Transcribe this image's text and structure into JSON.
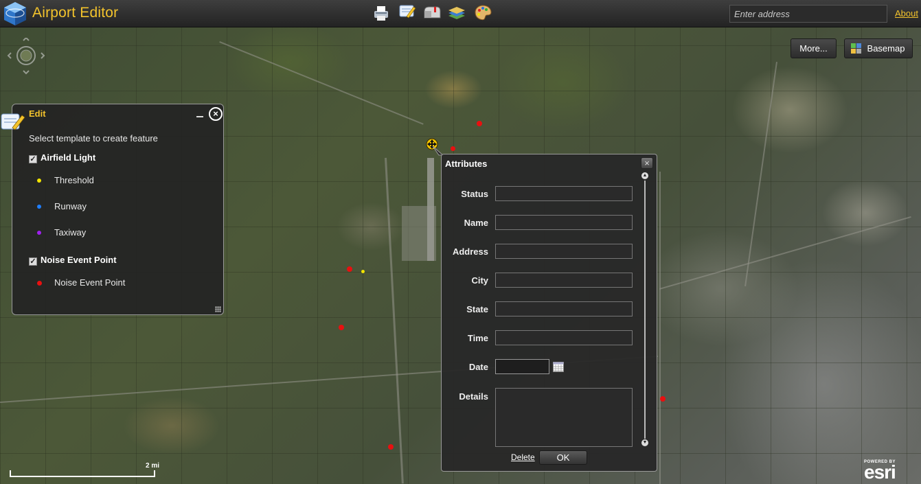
{
  "app": {
    "title": "Airport Editor"
  },
  "toolbar": {
    "tools": [
      "print-tool",
      "edit-tool",
      "mailbox-tool",
      "layers-tool",
      "palette-tool"
    ]
  },
  "search": {
    "placeholder": "Enter address"
  },
  "header": {
    "about_label": "About"
  },
  "map_buttons": {
    "more_label": "More...",
    "basemap_label": "Basemap"
  },
  "edit_panel": {
    "title": "Edit",
    "instruction": "Select template to create feature",
    "groups": [
      {
        "label": "Airfield Light",
        "checked": true,
        "templates": [
          {
            "label": "Threshold",
            "color": "#f2e400"
          },
          {
            "label": "Runway",
            "color": "#1f7fff"
          },
          {
            "label": "Taxiway",
            "color": "#a020f0"
          }
        ]
      },
      {
        "label": "Noise Event Point",
        "checked": true,
        "templates": [
          {
            "label": "Noise Event Point",
            "color": "#e81010"
          }
        ]
      }
    ]
  },
  "attributes": {
    "title": "Attributes",
    "fields": {
      "status": {
        "label": "Status",
        "value": ""
      },
      "name": {
        "label": "Name",
        "value": ""
      },
      "address": {
        "label": "Address",
        "value": ""
      },
      "city": {
        "label": "City",
        "value": ""
      },
      "state": {
        "label": "State",
        "value": ""
      },
      "time": {
        "label": "Time",
        "value": ""
      },
      "date": {
        "label": "Date",
        "value": ""
      },
      "details": {
        "label": "Details",
        "value": ""
      }
    },
    "delete_label": "Delete",
    "ok_label": "OK"
  },
  "scale": {
    "label": "2 mi"
  },
  "branding": {
    "powered_by": "POWERED BY",
    "esri": "esri"
  },
  "colors": {
    "accent": "#f3c32c",
    "noise_point": "#e81010"
  }
}
